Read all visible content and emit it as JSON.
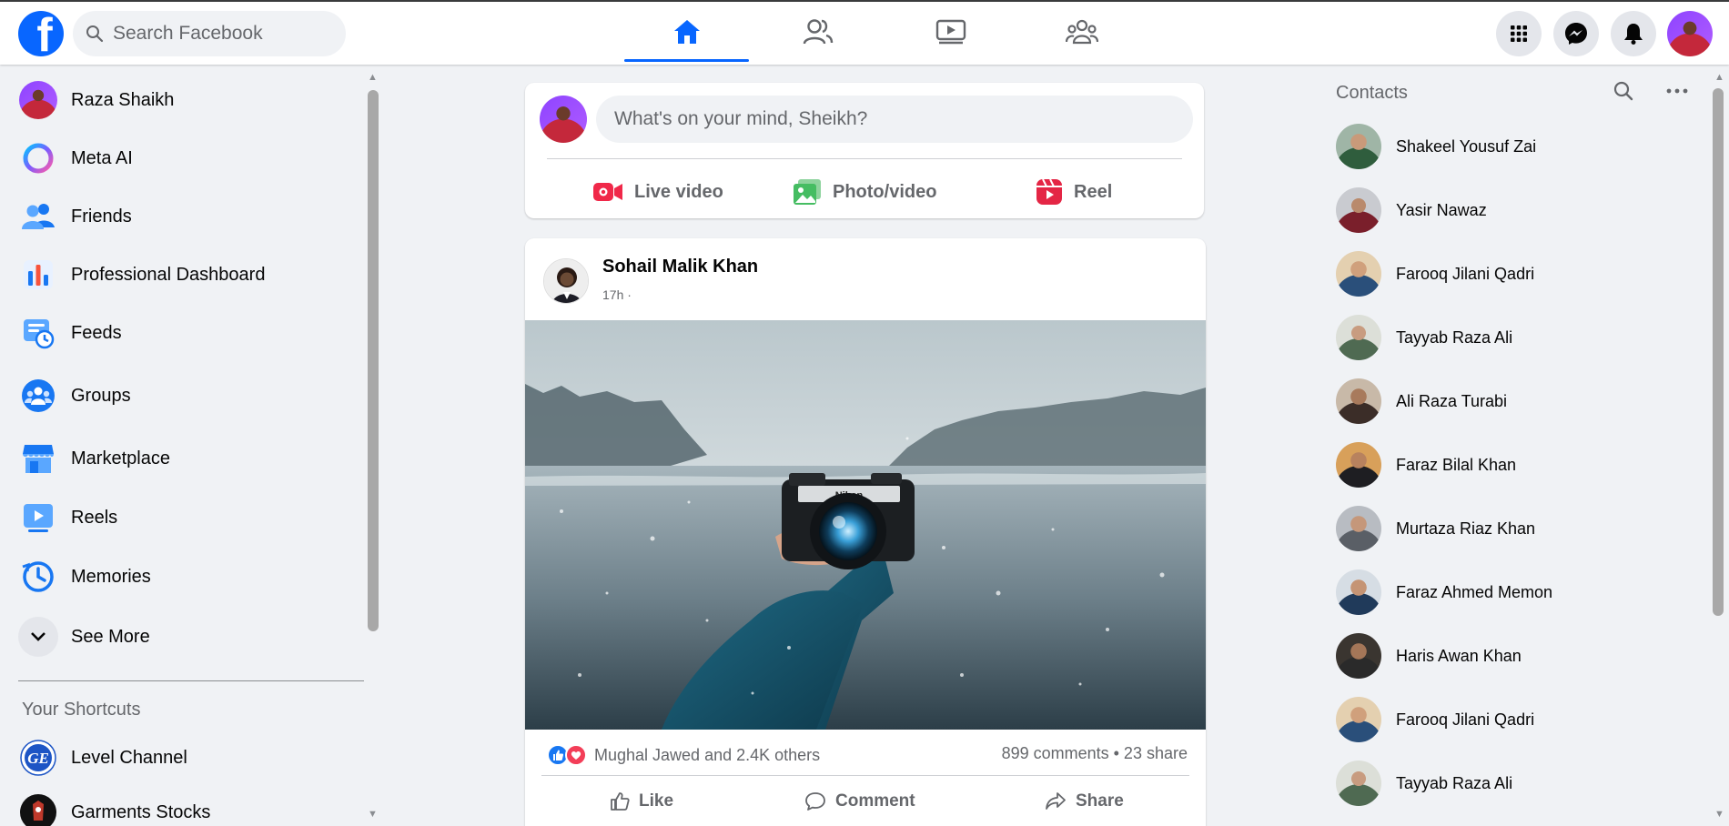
{
  "header": {
    "search_placeholder": "Search Facebook",
    "logo_letter": "f",
    "nav_tabs": [
      {
        "name": "home",
        "icon": "home-icon",
        "active": true
      },
      {
        "name": "friends",
        "icon": "friends-icon",
        "active": false
      },
      {
        "name": "video",
        "icon": "video-icon",
        "active": false
      },
      {
        "name": "groups",
        "icon": "groups-icon",
        "active": false
      }
    ],
    "right_buttons": [
      "menu-grid-icon",
      "messenger-icon",
      "notifications-icon",
      "profile-avatar"
    ]
  },
  "left_sidebar": {
    "items": [
      {
        "label": "Raza Shaikh",
        "icon": "profile-avatar"
      },
      {
        "label": "Meta AI",
        "icon": "meta-ai-icon"
      },
      {
        "label": "Friends",
        "icon": "friends-icon"
      },
      {
        "label": "Professional Dashboard",
        "icon": "dashboard-icon"
      },
      {
        "label": "Feeds",
        "icon": "feeds-icon"
      },
      {
        "label": "Groups",
        "icon": "groups-icon"
      },
      {
        "label": "Marketplace",
        "icon": "marketplace-icon"
      },
      {
        "label": "Reels",
        "icon": "reels-icon"
      },
      {
        "label": "Memories",
        "icon": "memories-icon"
      },
      {
        "label": "See More",
        "icon": "chevron-down-icon"
      }
    ],
    "shortcuts_title": "Your Shortcuts",
    "shortcuts": [
      {
        "label": "Level Channel",
        "icon": "ge-logo"
      },
      {
        "label": "Garments Stocks",
        "icon": "garments-logo"
      }
    ]
  },
  "composer": {
    "placeholder": "What's on your mind, Sheikh?",
    "actions": [
      {
        "label": "Live video",
        "icon": "live-video-icon"
      },
      {
        "label": "Photo/video",
        "icon": "photo-icon"
      },
      {
        "label": "Reel",
        "icon": "reel-icon"
      }
    ]
  },
  "post": {
    "author": "Sohail Malik Khan",
    "time": "17h ·",
    "image_subject": "hand-holding-nikon-camera-lake",
    "camera_brand": "Nikon",
    "reactions_text": "Mughal Jawed and 2.4K others",
    "counts_text": "899 comments • 23 share",
    "actions": [
      {
        "label": "Like",
        "icon": "like-icon"
      },
      {
        "label": "Comment",
        "icon": "comment-icon"
      },
      {
        "label": "Share",
        "icon": "share-icon"
      }
    ]
  },
  "contacts": {
    "title": "Contacts",
    "list": [
      "Shakeel Yousuf Zai",
      "Yasir Nawaz",
      "Farooq Jilani Qadri",
      "Tayyab Raza Ali",
      "Ali Raza Turabi",
      "Faraz Bilal Khan",
      "Murtaza Riaz Khan",
      "Faraz Ahmed Memon",
      "Haris Awan Khan",
      "Farooq Jilani Qadri",
      "Tayyab Raza Ali"
    ]
  },
  "colors": {
    "brand": "#0866ff",
    "background": "#f0f2f5",
    "live_red": "#f02849",
    "photo_green": "#45bd62",
    "reel_pink": "#e42645"
  }
}
